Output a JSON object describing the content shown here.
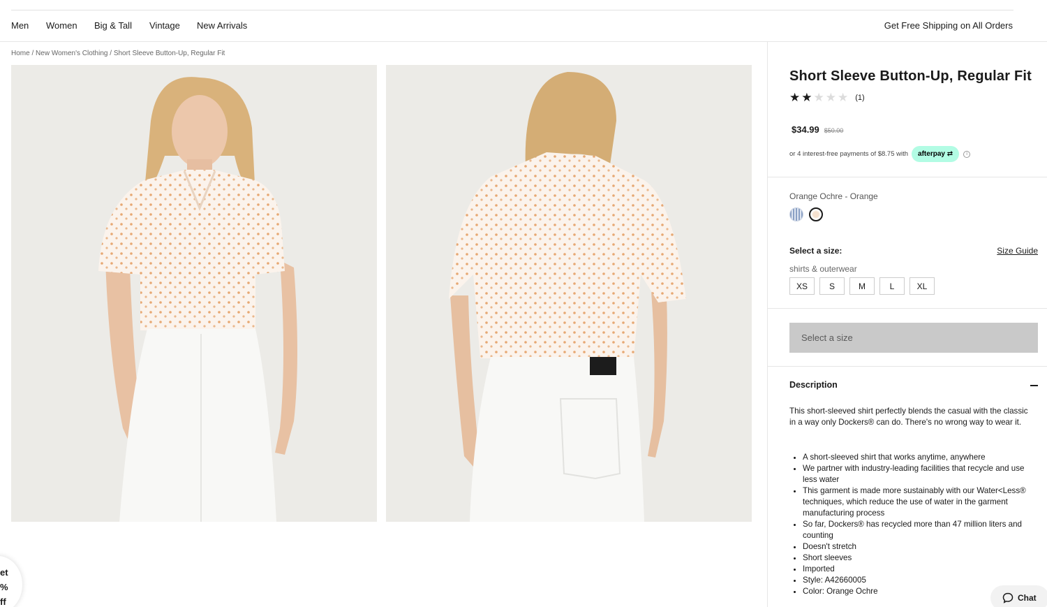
{
  "nav": {
    "links": [
      "Men",
      "Women",
      "Big & Tall",
      "Vintage",
      "New Arrivals"
    ],
    "promo": "Get Free Shipping on All Orders"
  },
  "breadcrumb": {
    "home": "Home",
    "sep1": " / ",
    "category": "New Women's Clothing",
    "sep2": " / ",
    "current": "Short Sleeve Button-Up, Regular Fit"
  },
  "product": {
    "title": "Short Sleeve Button-Up, Regular Fit",
    "rating": 2,
    "rating_max": 5,
    "review_count": "(1)",
    "price": "$34.99",
    "original_price": "$50.00",
    "afterpay_text": "or 4 interest-free payments of $8.75 with",
    "afterpay_label": "afterpay",
    "info_icon": "i",
    "color_name": "Orange Ochre - Orange",
    "swatches": [
      "blue-stripe",
      "orange-ochre"
    ],
    "size_label": "Select a size:",
    "size_guide": "Size Guide",
    "size_category": "shirts & outerwear",
    "sizes": [
      "XS",
      "S",
      "M",
      "L",
      "XL"
    ],
    "add_button": "Select a size",
    "description_heading": "Description",
    "description": "This short-sleeved shirt perfectly blends the casual with the classic in a way only Dockers® can do. There's no wrong way to wear it.",
    "features": [
      "A short-sleeved shirt that works anytime, anywhere",
      "We partner with industry-leading facilities that recycle and use less water",
      "This garment is made more sustainably with our Water<Less® techniques, which reduce the use of water in the garment manufacturing process",
      "So far, Dockers® has recycled more than 47 million liters and counting",
      "Doesn't stretch",
      "Short sleeves",
      "Imported",
      "Style: A42660005",
      "Color: Orange Ochre"
    ]
  },
  "promo_tab": {
    "line1": "et",
    "line2": "%",
    "line3": "ff"
  },
  "chat": {
    "label": "Chat"
  },
  "colors": {
    "accent_afterpay": "#b2fce4",
    "button_disabled": "#c9c9c9",
    "photo_bg": "#ecebe7"
  }
}
